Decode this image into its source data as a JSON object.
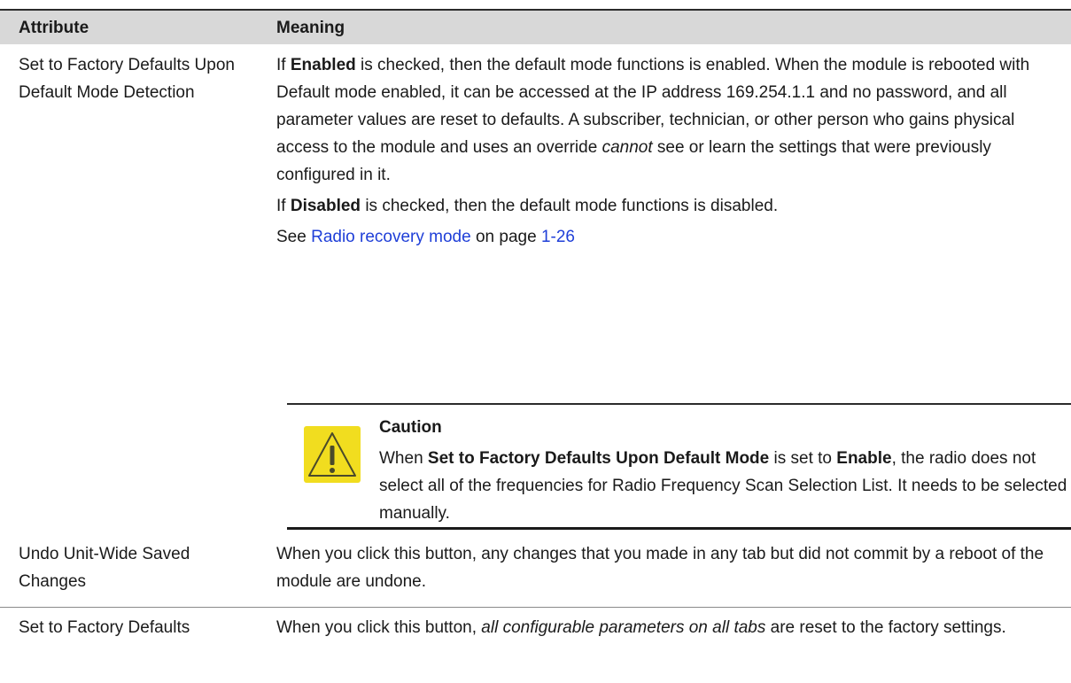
{
  "header": {
    "attribute": "Attribute",
    "meaning": "Meaning"
  },
  "row1": {
    "attribute": "Set to Factory Defaults Upon Default Mode Detection",
    "p1": {
      "a": "If ",
      "b": "Enabled",
      "c": " is checked, then the default mode functions is enabled. When the module is rebooted with Default mode enabled, it can be accessed at the IP address 169.254.1.1 and no password, and all parameter values are reset to defaults. A subscriber, technician, or other person who gains physical access to the module and uses an override ",
      "d": "cannot",
      "e": " see or learn the settings that were previously configured in it."
    },
    "p2": {
      "a": "If ",
      "b": "Disabled",
      "c": " is checked, then the default mode functions is disabled."
    },
    "p3": {
      "a": "See ",
      "link": "Radio recovery mode",
      "b": "  on page ",
      "page": "1-26"
    },
    "caution": {
      "title": "Caution",
      "a": "When ",
      "b": "Set to Factory Defaults Upon Default Mode",
      "c": " is set to ",
      "d": "Enable",
      "e": ", the radio does not select all of the frequencies for Radio Frequency Scan Selection List. It needs to be selected manually."
    }
  },
  "row2": {
    "attribute": "Undo Unit-Wide Saved Changes",
    "meaning": "When you click this button, any changes that you made in any tab but did not commit by a reboot of the module are undone."
  },
  "row3": {
    "attribute": "Set to Factory Defaults",
    "a": "When you click this button, ",
    "b": "all configurable parameters on all tabs",
    "c": " are reset to the factory settings."
  },
  "colors": {
    "header_bg": "#d8d8d8",
    "link": "#1f3fd8",
    "icon_yellow": "#f1dd1f"
  },
  "icons": {
    "caution": "warning-triangle-icon"
  }
}
